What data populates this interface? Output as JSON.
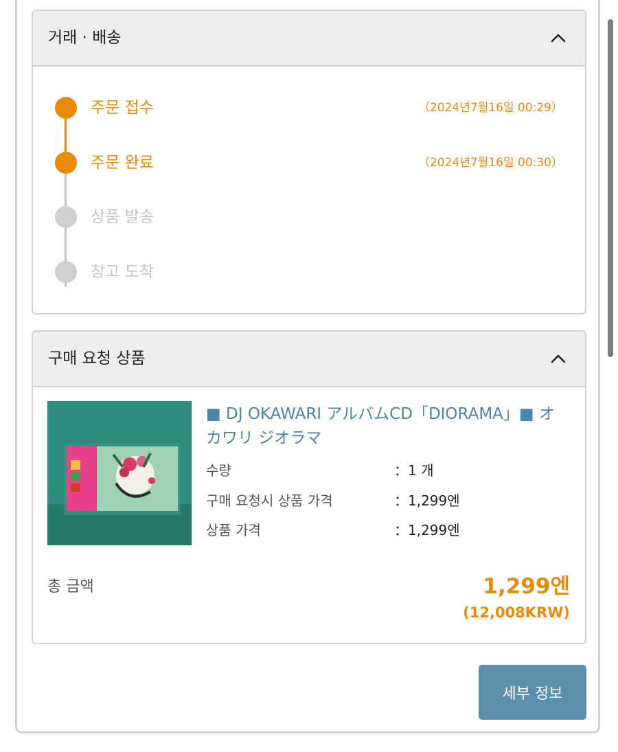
{
  "trade_panel": {
    "title": "거래 · 배송",
    "steps": [
      {
        "label": "주문 접수",
        "time": "（2024년7월16일 00:29）",
        "status": "done"
      },
      {
        "label": "주문 완료",
        "time": "（2024년7월16일 00:30）",
        "status": "done"
      },
      {
        "label": "상품 발송",
        "time": "",
        "status": "pending"
      },
      {
        "label": "창고 도착",
        "time": "",
        "status": "pending"
      }
    ]
  },
  "product_panel": {
    "title": "구매 요청 상품",
    "product": {
      "title": "■ DJ OKAWARI アルバムCD「DIORAMA」■ オカワリ ジオラマ",
      "rows": [
        {
          "label": "수량",
          "value": "：1 개"
        },
        {
          "label": "구매 요청시 상품 가격",
          "value": "：1,299엔"
        },
        {
          "label": "상품 가격",
          "value": "：1,299엔"
        }
      ]
    },
    "total_label": "총 금액",
    "total_jpy": "1,299엔",
    "total_krw": "(12,008KRW)"
  },
  "detail_button_label": "세부 정보",
  "colors": {
    "accent": "#ea8a0c",
    "pending": "#c4c4c4",
    "link": "#4a86a6",
    "button": "#5b8fab"
  }
}
